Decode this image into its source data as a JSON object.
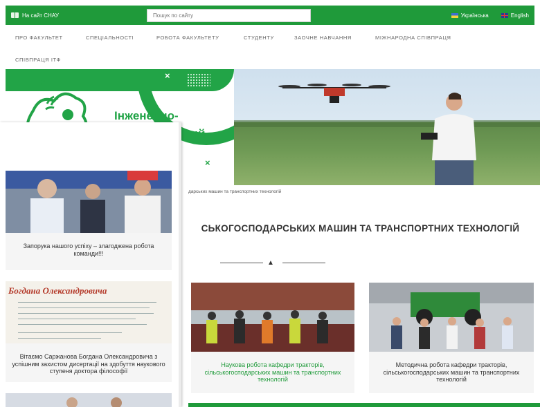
{
  "topbar": {
    "site_link": "На сайт СНАУ",
    "search_placeholder": "Пошук по сайту",
    "lang_ua": "Українська",
    "lang_en": "English"
  },
  "nav": {
    "items": [
      "Про факультет",
      "Спеціальності",
      "Робота факультету",
      "Студенту",
      "Заочне навчання",
      "Міжнародна співпраця",
      "Співпраця ІТФ"
    ]
  },
  "hero": {
    "title_line1": "Інженерно-",
    "title_line2": "нний"
  },
  "breadcrumb": "дарських машин та транспортних технологій",
  "page_title": "СЬКОГОСПОДАРСЬКИХ МАШИН ТА ТРАНСПОРТНИХ ТЕХНОЛОГІЙ",
  "cards": [
    {
      "caption": "Наукова робота кафедри тракторів, сільськогосподарських машин та транспортних технологій"
    },
    {
      "caption": "Методична робота кафедри тракторів, сільськогосподарських машин та транспортних технологій"
    }
  ],
  "side_news": [
    {
      "caption": "Запорука нашого успіху – злагоджена робота команди!!!"
    },
    {
      "caption": "Вітаємо Саржанова Богдана Олександровича з успішним захистом дисертації на здобуття наукового ступеня доктора філософії",
      "image_text": "Богдана Олександровича"
    }
  ],
  "colors": {
    "brand_green": "#1f9a3a",
    "accent_green": "#22a447"
  }
}
